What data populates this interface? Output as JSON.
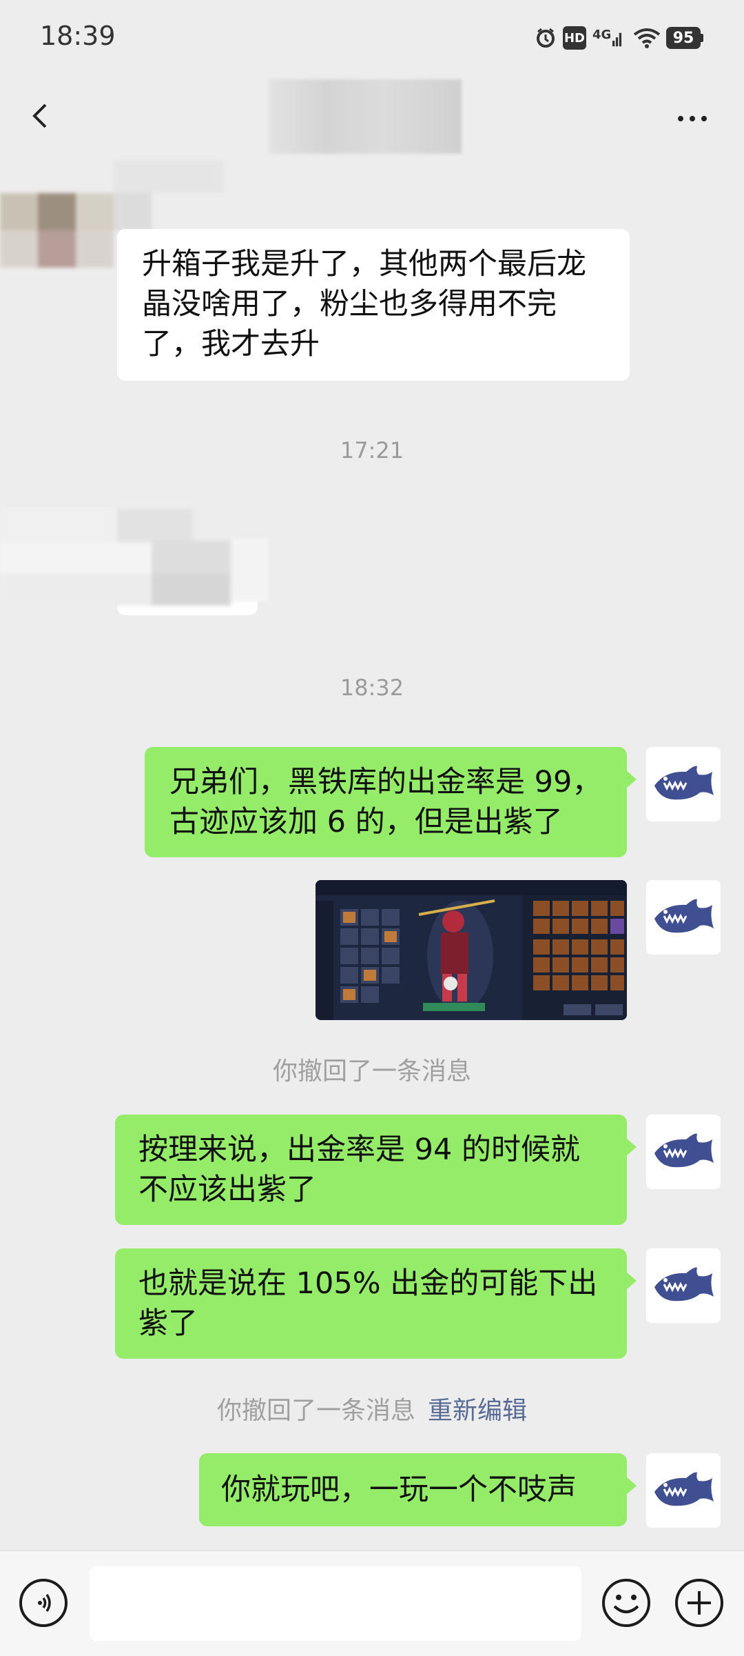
{
  "status_bar": {
    "time": "18:39",
    "icons": [
      "alarm-icon",
      "hd-icon",
      "4g-signal-icon",
      "wifi-icon",
      "battery-icon"
    ],
    "hd_label": "HD",
    "network_label": "4G",
    "battery": "95"
  },
  "header": {
    "back_icon": "chevron-left-icon",
    "more_icon": "more-dots-icon"
  },
  "messages": [
    {
      "side": "in",
      "text_lines": [
        "升箱子我是升了，其他两个最后龙",
        "晶没啥用了，粉尘也多得用不完",
        "了，我才去升"
      ]
    },
    {
      "side": "in",
      "text_lines": []
    },
    {
      "side": "out",
      "text_lines": [
        "兄弟们，黑铁库的出金率是 99，",
        "古迹应该加 6 的，但是出紫了"
      ]
    },
    {
      "side": "out",
      "type": "image"
    },
    {
      "side": "out",
      "text_lines": [
        "按理来说，出金率是 94 的时候就",
        "不应该出紫了"
      ]
    },
    {
      "side": "out",
      "text_lines": [
        "也就是说在 105% 出金的可能下出",
        "紫了"
      ]
    },
    {
      "side": "out",
      "text_lines": [
        "你就玩吧，一玩一个不吱声"
      ]
    }
  ],
  "timestamps": [
    "17:21",
    "18:32"
  ],
  "system_notes": {
    "recall_1": "你撤回了一条消息",
    "recall_2": "你撤回了一条消息",
    "reedit": "重新编辑"
  },
  "bottom_bar": {
    "input_value": "",
    "icons": [
      "voice-icon",
      "emoji-icon",
      "plus-icon"
    ]
  },
  "colors": {
    "background": "#ededed",
    "outgoing_bubble": "#95ec69",
    "incoming_bubble": "#ffffff",
    "link": "#576b95",
    "avatar_shark": "#3f4f91"
  }
}
